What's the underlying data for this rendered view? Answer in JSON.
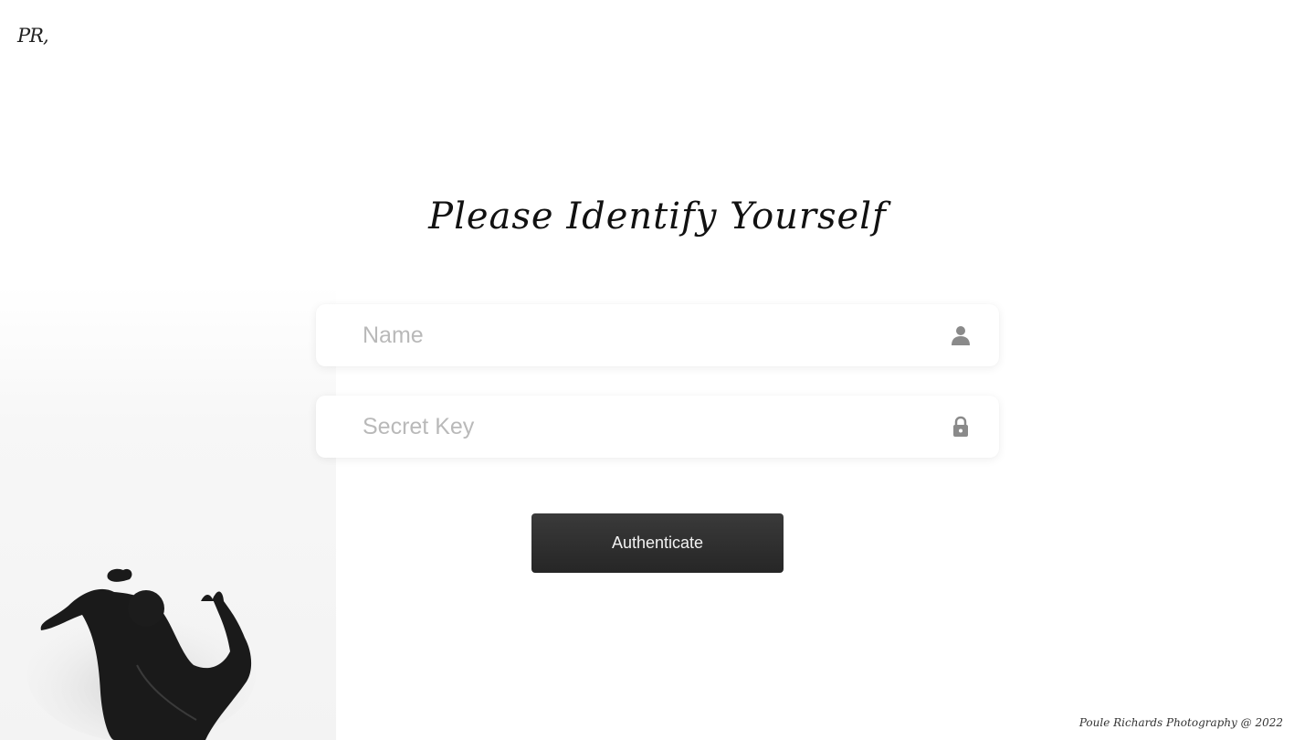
{
  "header": {
    "logo_text": "PR,"
  },
  "login": {
    "title": "Please Identify Yourself",
    "name_field": {
      "placeholder": "Name",
      "value": "",
      "icon": "person-icon"
    },
    "key_field": {
      "placeholder": "Secret Key",
      "value": "",
      "icon": "lock-icon"
    },
    "submit_label": "Authenticate"
  },
  "footer": {
    "copyright": "Poule Richards Photography @ 2022"
  },
  "colors": {
    "button_bg": "#2e2e2e",
    "button_text": "#f2f2f2",
    "placeholder": "#b9b9b9"
  }
}
